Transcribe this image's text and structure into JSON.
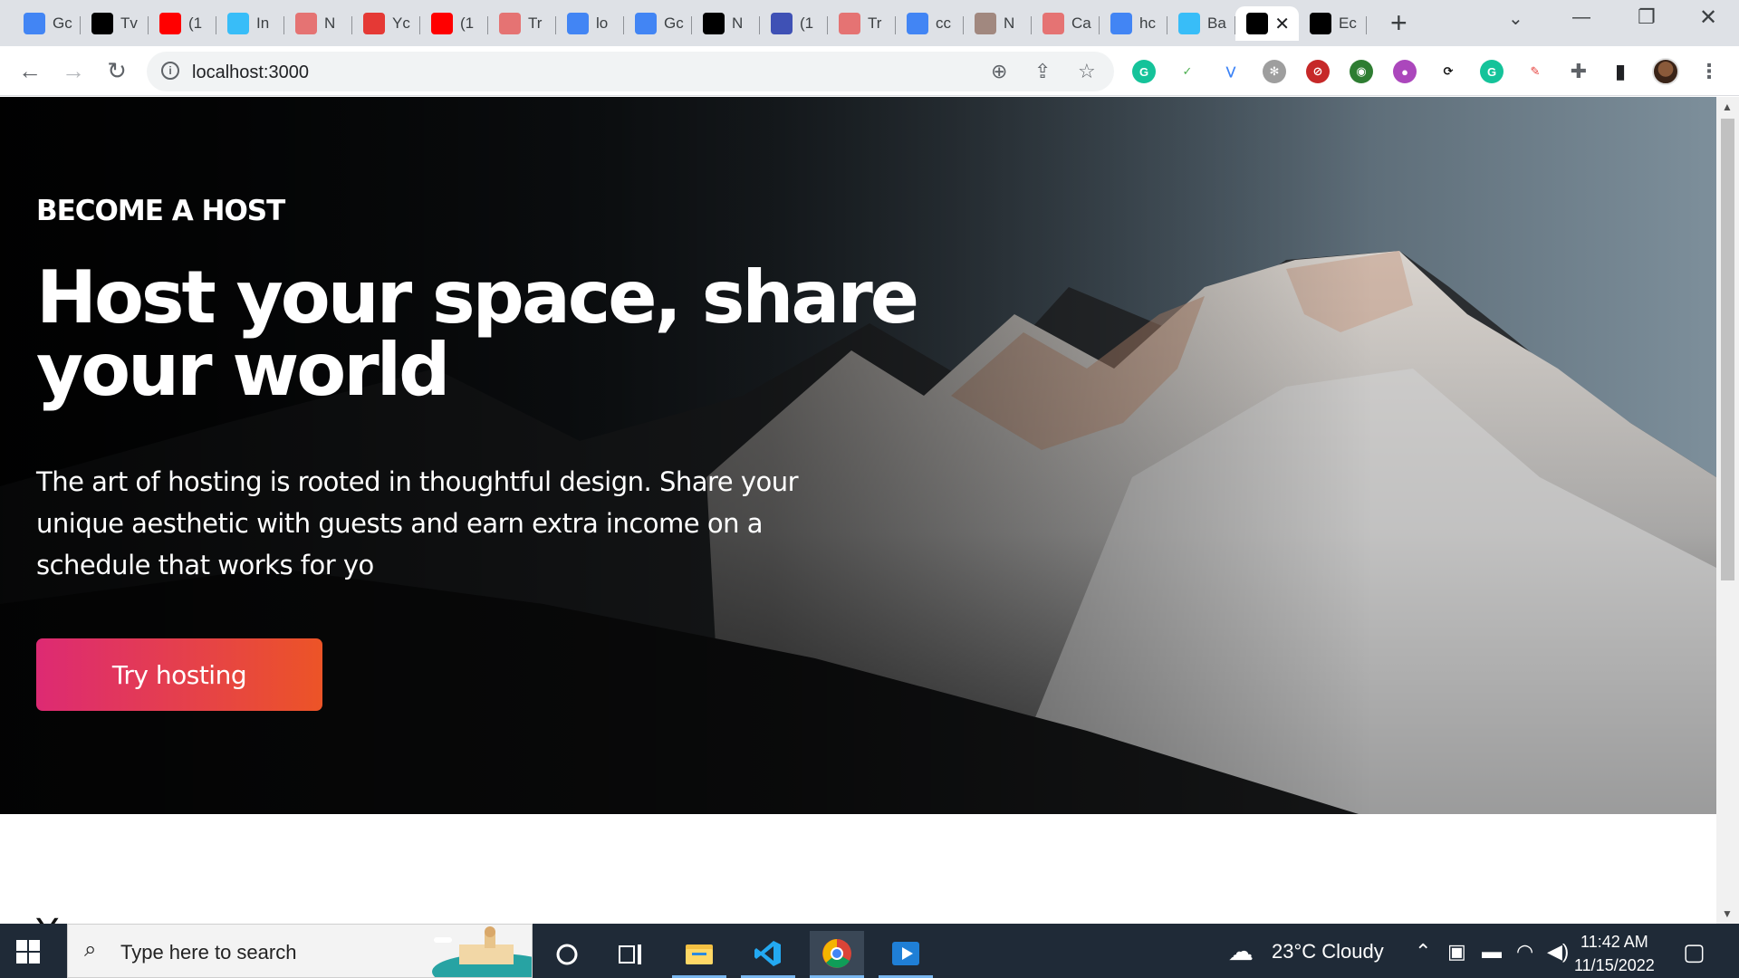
{
  "browser": {
    "tabs": [
      {
        "title": "Gc",
        "favicon": "calendar-15-icon",
        "color": "#4285f4"
      },
      {
        "title": "Tv",
        "favicon": "dev-icon",
        "color": "#000000"
      },
      {
        "title": "(1",
        "favicon": "youtube-icon",
        "color": "#ff0000"
      },
      {
        "title": "In",
        "favicon": "wave-icon",
        "color": "#38bdf8"
      },
      {
        "title": "N",
        "favicon": "openai-icon",
        "color": "#e57373"
      },
      {
        "title": "Yc",
        "favicon": "download-icon",
        "color": "#e53935"
      },
      {
        "title": "(1",
        "favicon": "youtube-icon",
        "color": "#ff0000"
      },
      {
        "title": "Tr",
        "favicon": "openai-icon",
        "color": "#e57373"
      },
      {
        "title": "lo",
        "favicon": "google-icon",
        "color": "#4285f4"
      },
      {
        "title": "Gc",
        "favicon": "calendar-15-icon",
        "color": "#4285f4"
      },
      {
        "title": "N",
        "favicon": "dev-icon",
        "color": "#000000"
      },
      {
        "title": "(1",
        "favicon": "notification-icon",
        "color": "#3f51b5"
      },
      {
        "title": "Tr",
        "favicon": "openai-icon",
        "color": "#e57373"
      },
      {
        "title": "cc",
        "favicon": "docs-icon",
        "color": "#4285f4"
      },
      {
        "title": "N",
        "favicon": "atom-icon",
        "color": "#a1887f"
      },
      {
        "title": "Ca",
        "favicon": "openai-icon",
        "color": "#e57373"
      },
      {
        "title": "hc",
        "favicon": "google-icon",
        "color": "#4285f4"
      },
      {
        "title": "Ba",
        "favicon": "wave-icon",
        "color": "#38bdf8"
      },
      {
        "title": "",
        "favicon": "triangle-icon",
        "color": "#000000",
        "active": true
      },
      {
        "title": "Ec",
        "favicon": "dev-icon",
        "color": "#000000"
      }
    ],
    "url": "localhost:3000",
    "new_tab_symbol": "+",
    "close_tab_symbol": "✕"
  },
  "hero": {
    "eyebrow": "BECOME A HOST",
    "headline": "Host your space, share your world",
    "lead": "The art of hosting is rooted in thoughtful design. Share your unique aesthetic with guests and earn extra income on a schedule that works for yo",
    "cta_label": "Try hosting",
    "cta_gradient_start": "#dd2a73",
    "cta_gradient_end": "#ec5427"
  },
  "below_fold_text": "Y",
  "taskbar": {
    "search_placeholder": "Type here to search",
    "weather": "23°C  Cloudy",
    "time": "11:42 AM",
    "date": "11/15/2022"
  }
}
